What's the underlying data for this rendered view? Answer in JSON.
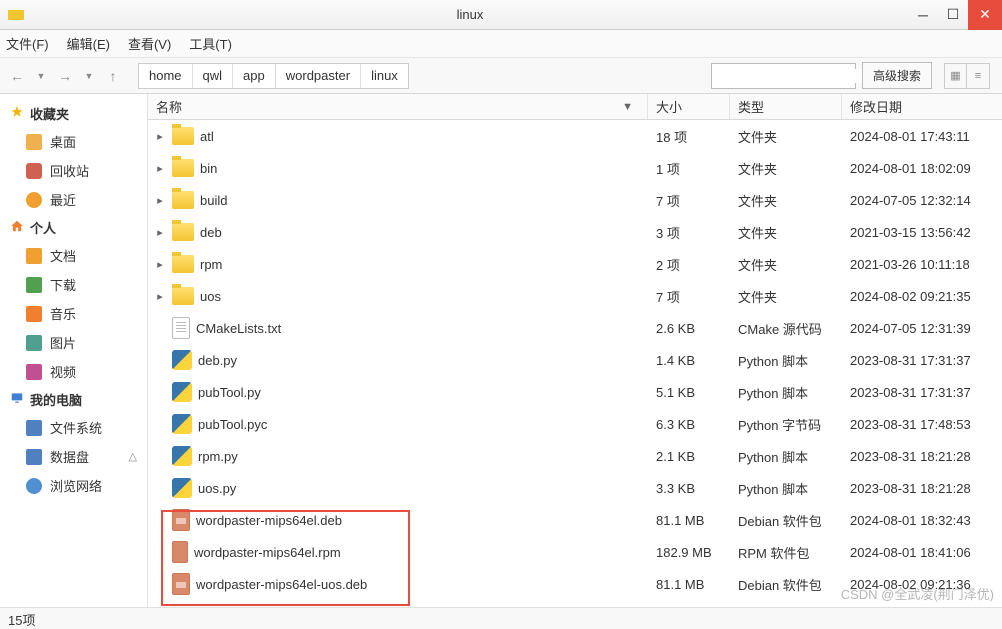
{
  "window": {
    "title": "linux"
  },
  "menu": {
    "file": "文件(F)",
    "edit": "编辑(E)",
    "view": "查看(V)",
    "tools": "工具(T)"
  },
  "breadcrumb": [
    "home",
    "qwl",
    "app",
    "wordpaster",
    "linux"
  ],
  "search": {
    "advanced": "高级搜索"
  },
  "sidebar": {
    "fav": {
      "label": "收藏夹",
      "items": [
        {
          "label": "桌面",
          "icon": "ic-desktop"
        },
        {
          "label": "回收站",
          "icon": "ic-trash"
        },
        {
          "label": "最近",
          "icon": "ic-recent"
        }
      ]
    },
    "personal": {
      "label": "个人",
      "items": [
        {
          "label": "文档",
          "icon": "ic-doc"
        },
        {
          "label": "下载",
          "icon": "ic-dl"
        },
        {
          "label": "音乐",
          "icon": "ic-music"
        },
        {
          "label": "图片",
          "icon": "ic-pic"
        },
        {
          "label": "视频",
          "icon": "ic-video"
        }
      ]
    },
    "computer": {
      "label": "我的电脑",
      "items": [
        {
          "label": "文件系统",
          "icon": "ic-fs"
        },
        {
          "label": "数据盘",
          "icon": "ic-data",
          "eject": true
        },
        {
          "label": "浏览网络",
          "icon": "ic-net"
        }
      ]
    }
  },
  "columns": {
    "name": "名称",
    "size": "大小",
    "type": "类型",
    "date": "修改日期"
  },
  "sort_indicator": "▼",
  "files": [
    {
      "name": "atl",
      "kind": "folder",
      "size": "18 项",
      "type": "文件夹",
      "date": "2024-08-01 17:43:11"
    },
    {
      "name": "bin",
      "kind": "folder",
      "size": "1 项",
      "type": "文件夹",
      "date": "2024-08-01 18:02:09"
    },
    {
      "name": "build",
      "kind": "folder",
      "size": "7 项",
      "type": "文件夹",
      "date": "2024-07-05 12:32:14"
    },
    {
      "name": "deb",
      "kind": "folder",
      "size": "3 项",
      "type": "文件夹",
      "date": "2021-03-15 13:56:42"
    },
    {
      "name": "rpm",
      "kind": "folder",
      "size": "2 项",
      "type": "文件夹",
      "date": "2021-03-26 10:11:18"
    },
    {
      "name": "uos",
      "kind": "folder",
      "size": "7 项",
      "type": "文件夹",
      "date": "2024-08-02 09:21:35"
    },
    {
      "name": "CMakeLists.txt",
      "kind": "text",
      "size": "2.6 KB",
      "type": "CMake 源代码",
      "date": "2024-07-05 12:31:39"
    },
    {
      "name": "deb.py",
      "kind": "py",
      "size": "1.4 KB",
      "type": "Python 脚本",
      "date": "2023-08-31 17:31:37"
    },
    {
      "name": "pubTool.py",
      "kind": "py",
      "size": "5.1 KB",
      "type": "Python 脚本",
      "date": "2023-08-31 17:31:37"
    },
    {
      "name": "pubTool.pyc",
      "kind": "py",
      "size": "6.3 KB",
      "type": "Python 字节码",
      "date": "2023-08-31 17:48:53"
    },
    {
      "name": "rpm.py",
      "kind": "py",
      "size": "2.1 KB",
      "type": "Python 脚本",
      "date": "2023-08-31 18:21:28"
    },
    {
      "name": "uos.py",
      "kind": "py",
      "size": "3.3 KB",
      "type": "Python 脚本",
      "date": "2023-08-31 18:21:28"
    },
    {
      "name": "wordpaster-mips64el.deb",
      "kind": "deb",
      "size": "81.1 MB",
      "type": "Debian 软件包",
      "date": "2024-08-01 18:32:43"
    },
    {
      "name": "wordpaster-mips64el.rpm",
      "kind": "rpm",
      "size": "182.9 MB",
      "type": "RPM 软件包",
      "date": "2024-08-01 18:41:06"
    },
    {
      "name": "wordpaster-mips64el-uos.deb",
      "kind": "deb",
      "size": "81.1 MB",
      "type": "Debian 软件包",
      "date": "2024-08-02 09:21:36"
    }
  ],
  "status": "15项",
  "watermark": "CSDN @全武凌(荆门泽优)"
}
